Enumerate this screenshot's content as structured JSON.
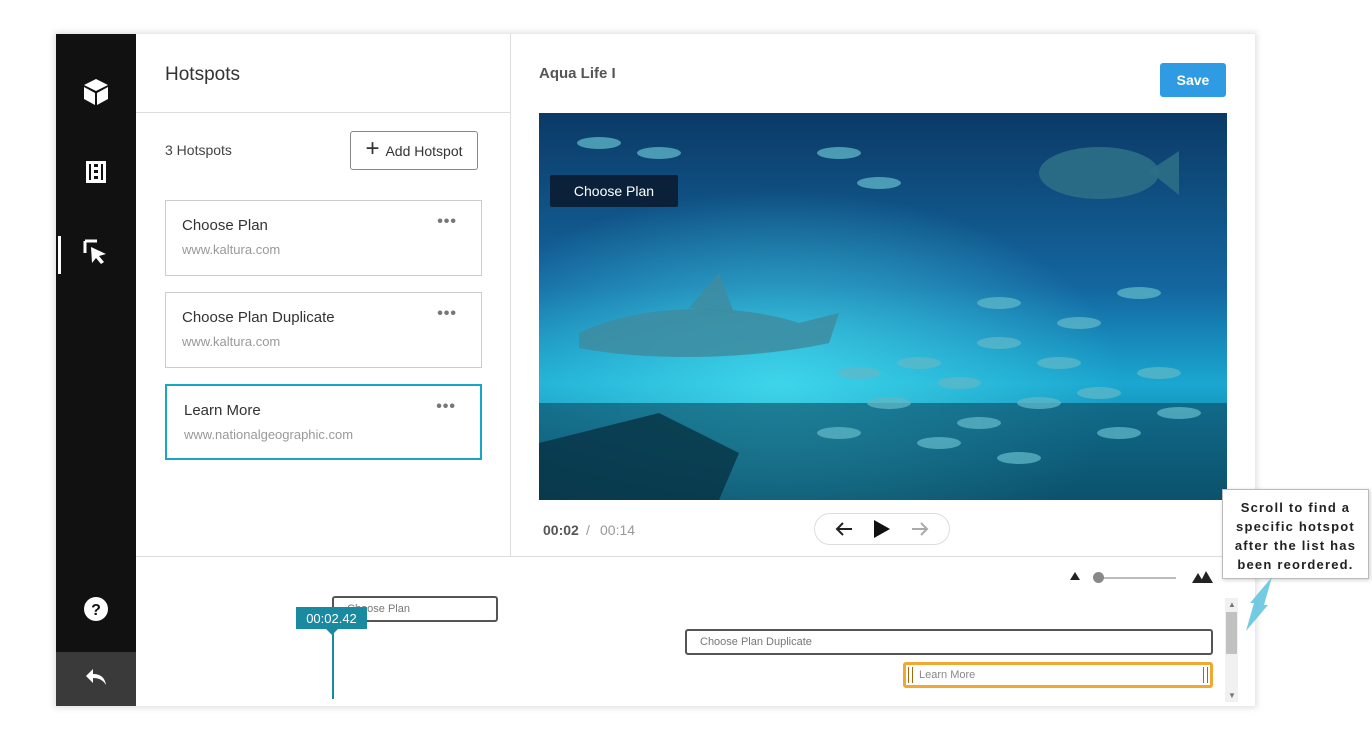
{
  "sidebar": {
    "items": [
      {
        "icon": "cube-icon"
      },
      {
        "icon": "film-strip-icon"
      },
      {
        "icon": "cursor-click-icon",
        "active": true
      }
    ],
    "help_icon": "question-circle-icon",
    "back_icon": "reply-arrow-icon"
  },
  "panel": {
    "title": "Hotspots",
    "count_label": "3 Hotspots",
    "add_button_label": "Add Hotspot",
    "hotspots": [
      {
        "title": "Choose Plan",
        "url": "www.kaltura.com",
        "menu": "•••"
      },
      {
        "title": "Choose Plan Duplicate",
        "url": "www.kaltura.com",
        "menu": "•••"
      },
      {
        "title": "Learn More",
        "url": "www.nationalgeographic.com",
        "menu": "•••",
        "selected": true
      }
    ]
  },
  "video": {
    "title": "Aqua Life I",
    "save_label": "Save",
    "overlay_label": "Choose Plan",
    "current_time": "00:02",
    "separator": "/",
    "total_time": "00:14"
  },
  "timeline": {
    "playhead_time": "00:02.42",
    "clips": [
      {
        "label": "Choose Plan"
      },
      {
        "label": "Choose Plan Duplicate"
      },
      {
        "label": "Learn More",
        "selected": true
      }
    ]
  },
  "callout": {
    "text": "Scroll to find a specific hotspot after the list has been reordered."
  },
  "colors": {
    "accent": "#1aa5c0",
    "save_button": "#2f9be2",
    "playhead": "#1a8aa0",
    "selected_clip": "#f0a830",
    "sidebar_bg": "#111111"
  }
}
